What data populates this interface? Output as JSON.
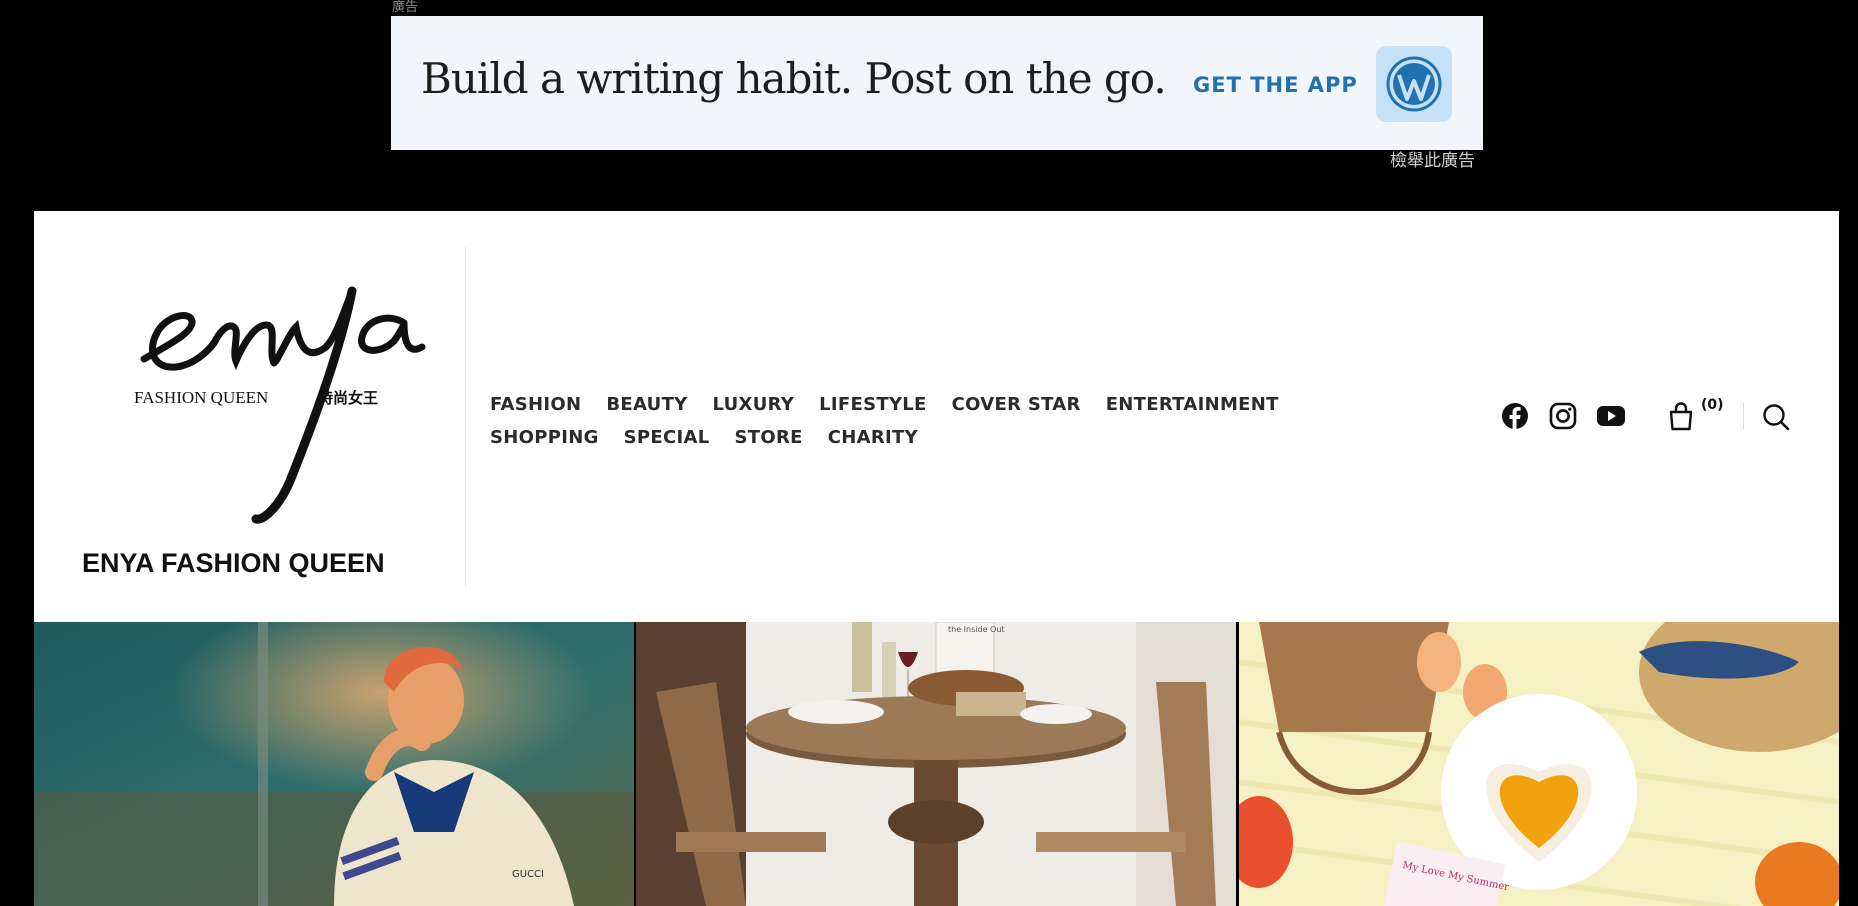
{
  "ad": {
    "top_label": "廣告",
    "headline": "Build a writing habit. Post on the go.",
    "cta": "GET THE APP",
    "report_link": "檢舉此廣告"
  },
  "site": {
    "logo": {
      "script": "enya",
      "tagline": "FASHION QUEEN",
      "tagline_cn": "時尚女王"
    },
    "title": "ENYA FASHION QUEEN"
  },
  "nav": {
    "row1": [
      "FASHION",
      "BEAUTY",
      "LUXURY",
      "LIFESTYLE",
      "COVER STAR",
      "ENTERTAINMENT"
    ],
    "row2": [
      "SHOPPING",
      "SPECIAL",
      "STORE",
      "CHARITY"
    ]
  },
  "social": {
    "icons": [
      "facebook-icon",
      "instagram-icon",
      "youtube-icon"
    ]
  },
  "cart": {
    "count": "(0)"
  },
  "tiles": [
    {
      "name": "featured-tile-fashion",
      "jacket_text": "GUCCI"
    },
    {
      "name": "featured-tile-lifestyle",
      "sign_text": "the Inside Out"
    },
    {
      "name": "featured-tile-beauty",
      "card_text": "My Love My Summer"
    }
  ],
  "colors": {
    "page_bg": "#000000",
    "ad_bg": "#f2f6fa",
    "ad_cta": "#2271b1",
    "header_bg": "#ffffff",
    "nav_text": "#2b2b2b"
  }
}
